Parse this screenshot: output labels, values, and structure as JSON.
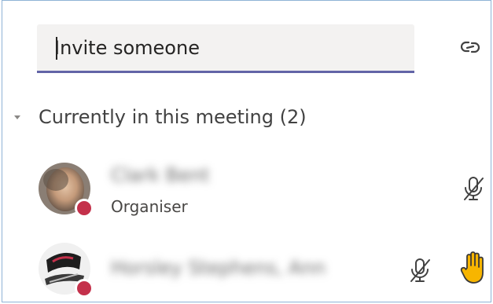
{
  "invite": {
    "placeholder": "Invite someone",
    "value": "",
    "link_icon": "link-icon"
  },
  "section": {
    "label": "Currently in this meeting (2)",
    "chevron_icon": "chevron-down-icon"
  },
  "participants": [
    {
      "name": "Clark Bent",
      "role": "Organiser",
      "presence_color": "#c4314b",
      "mic_icon": "mic-off-icon"
    },
    {
      "name": "Horsley Stephens, Ann",
      "role": "",
      "presence_color": "#c4314b",
      "mic_icon": "mic-off-icon",
      "hand_icon": "raised-hand-icon"
    }
  ],
  "colors": {
    "accent": "#6264a7",
    "hand": "#f7b500",
    "busy": "#c4314b"
  }
}
